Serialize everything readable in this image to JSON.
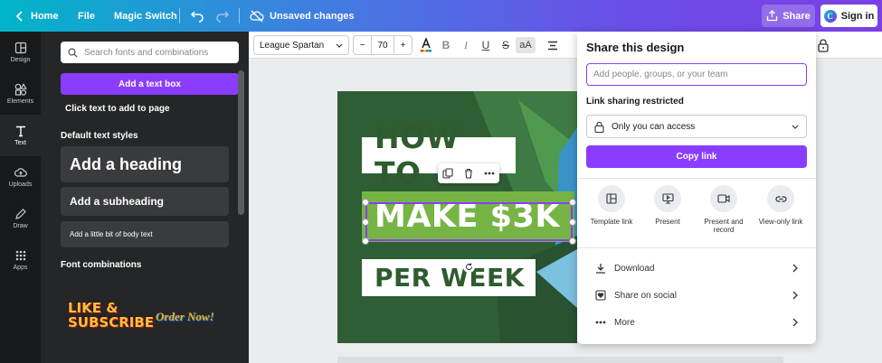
{
  "topbar": {
    "home": "Home",
    "file": "File",
    "magic_switch": "Magic Switch",
    "status": "Unsaved changes",
    "share": "Share",
    "sign_in": "Sign in"
  },
  "rail": [
    {
      "label": "Design",
      "icon": "layout-icon"
    },
    {
      "label": "Elements",
      "icon": "shapes-icon"
    },
    {
      "label": "Text",
      "icon": "text-icon"
    },
    {
      "label": "Uploads",
      "icon": "cloud-upload-icon"
    },
    {
      "label": "Draw",
      "icon": "pen-icon"
    },
    {
      "label": "Apps",
      "icon": "apps-grid-icon"
    }
  ],
  "panel": {
    "search_placeholder": "Search fonts and combinations",
    "add_text_box": "Add a text box",
    "hint": "Click text to add to page",
    "default_styles_heading": "Default text styles",
    "heading": "Add a heading",
    "subheading": "Add a subheading",
    "body": "Add a little bit of body text",
    "combinations_heading": "Font combinations",
    "combo1_line1": "LIKE &",
    "combo1_line2": "SUBSCRIBE",
    "combo2": "Order Now!"
  },
  "toolbar": {
    "font": "League Spartan",
    "minus": "−",
    "size": "70",
    "plus": "+",
    "bold": "B",
    "italic": "I",
    "underline": "U",
    "strike": "S",
    "case": "aA"
  },
  "design": {
    "line1": "HOW TO",
    "line2": "MAKE $3K",
    "line3": "PER WEEK",
    "colors": {
      "bg": "#2f5e34",
      "accent": "#76b545",
      "text": "#2e5c2f"
    }
  },
  "share_panel": {
    "title": "Share this design",
    "input_placeholder": "Add people, groups, or your team",
    "link_label": "Link sharing restricted",
    "access_value": "Only you can access",
    "copy_link": "Copy link",
    "options": [
      {
        "label": "Template link",
        "icon": "template-icon"
      },
      {
        "label": "Present",
        "icon": "present-icon"
      },
      {
        "label": "Present and record",
        "icon": "record-icon"
      },
      {
        "label": "View-only link",
        "icon": "link-icon"
      }
    ],
    "rows": [
      {
        "label": "Download",
        "icon": "download-icon"
      },
      {
        "label": "Share on social",
        "icon": "heart-icon"
      },
      {
        "label": "More",
        "icon": "more-icon"
      }
    ]
  },
  "colors": {
    "brand_purple": "#8b3dff",
    "rail_bg": "#18191b",
    "panel_bg": "#252627"
  }
}
